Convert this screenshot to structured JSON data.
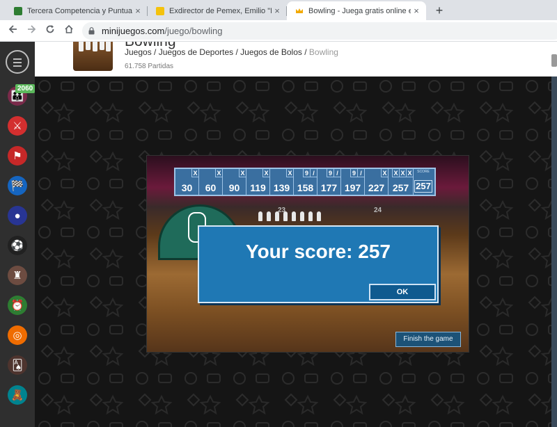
{
  "browser": {
    "tabs": [
      {
        "title": "Tercera Competencia y Puntuació",
        "active": false,
        "favicon_color": "#2e7d32"
      },
      {
        "title": "Exdirector de Pemex, Emilio \"N\", ",
        "active": false,
        "favicon_color": "#f4c20d"
      },
      {
        "title": "Bowling - Juega gratis online en",
        "active": true,
        "favicon_color": "#f2a900"
      }
    ],
    "new_tab_symbol": "+",
    "close_symbol": "×",
    "url_host": "minijuegos.com",
    "url_path": "/juego/bowling"
  },
  "sidebar": {
    "badge_count": "2060",
    "icons": [
      {
        "name": "community-icon",
        "color": "#7a2a4a",
        "glyph": "👪"
      },
      {
        "name": "action-icon",
        "color": "#d32f2f",
        "glyph": "⚔"
      },
      {
        "name": "adventure-icon",
        "color": "#c62828",
        "glyph": "⚑"
      },
      {
        "name": "racing-icon",
        "color": "#1565c0",
        "glyph": "🏁"
      },
      {
        "name": "arcade-icon",
        "color": "#283593",
        "glyph": "●"
      },
      {
        "name": "sports-icon",
        "color": "#212121",
        "glyph": "⚽"
      },
      {
        "name": "strategy-icon",
        "color": "#6d4c41",
        "glyph": "♜"
      },
      {
        "name": "skill-icon",
        "color": "#2e7d32",
        "glyph": "⏰"
      },
      {
        "name": "shooting-icon",
        "color": "#ef6c00",
        "glyph": "◎"
      },
      {
        "name": "cards-icon",
        "color": "#4e342e",
        "glyph": "🂡"
      },
      {
        "name": "kids-icon",
        "color": "#00838f",
        "glyph": "🧸"
      }
    ]
  },
  "page": {
    "game_title": "Bowling",
    "breadcrumb": [
      "Juegos",
      "Juegos de Deportes",
      "Juegos de Bolos",
      "Bowling"
    ],
    "breadcrumb_separator": " / ",
    "plays": "61.758 Partidas"
  },
  "game": {
    "lane_numbers": [
      "23",
      "24"
    ],
    "frames": [
      {
        "marks": [
          "X"
        ],
        "total": "30"
      },
      {
        "marks": [
          "X"
        ],
        "total": "60"
      },
      {
        "marks": [
          "X"
        ],
        "total": "90"
      },
      {
        "marks": [
          "X"
        ],
        "total": "119"
      },
      {
        "marks": [
          "X"
        ],
        "total": "139"
      },
      {
        "marks": [
          "9",
          "/"
        ],
        "total": "158"
      },
      {
        "marks": [
          "9",
          "/"
        ],
        "total": "177"
      },
      {
        "marks": [
          "9",
          "/"
        ],
        "total": "197"
      },
      {
        "marks": [
          "X"
        ],
        "total": "227"
      },
      {
        "marks": [
          "X",
          "X",
          "X"
        ],
        "total": "257"
      }
    ],
    "total_label": "SCORE",
    "total_score": "257",
    "dialog_text": "Your score: 257",
    "ok_label": "OK",
    "finish_label": "Finish the game"
  }
}
